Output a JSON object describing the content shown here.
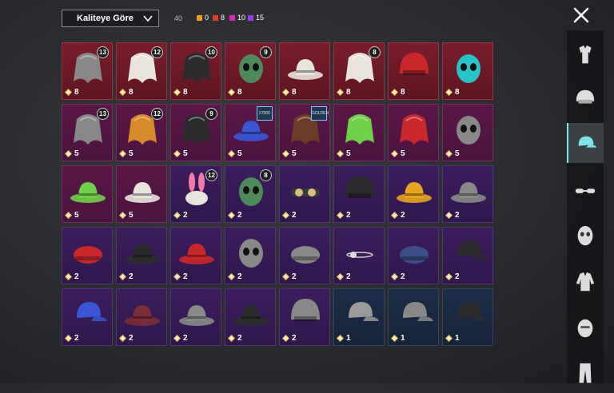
{
  "top": {
    "sort_label": "Kaliteye Göre",
    "total": "40",
    "quality_counts": [
      {
        "color": "#f0a020",
        "value": "0"
      },
      {
        "color": "#e23a2e",
        "value": "8"
      },
      {
        "color": "#d928b8",
        "value": "10"
      },
      {
        "color": "#9a3de6",
        "value": "15"
      }
    ]
  },
  "items": [
    {
      "quality": "red",
      "icon": "witch-hat-hair-icon",
      "level": "13",
      "count": "8"
    },
    {
      "quality": "red",
      "icon": "white-hair-bunny-icon",
      "level": "12",
      "count": "8"
    },
    {
      "quality": "red",
      "icon": "dark-curly-hair-icon",
      "level": "10",
      "count": "8"
    },
    {
      "quality": "red",
      "icon": "zombie-mask-icon",
      "level": "9",
      "count": "8"
    },
    {
      "quality": "red",
      "icon": "white-cowboy-hat-icon",
      "level": "",
      "count": "8"
    },
    {
      "quality": "red",
      "icon": "white-hair-bow-icon",
      "level": "8",
      "count": "8"
    },
    {
      "quality": "red",
      "icon": "red-helmet-icon",
      "level": "",
      "count": "8"
    },
    {
      "quality": "red",
      "icon": "cyan-horned-mask-icon",
      "level": "",
      "count": "8"
    },
    {
      "quality": "magenta",
      "icon": "hat-hair-duo-icon",
      "level": "13",
      "count": "5"
    },
    {
      "quality": "magenta",
      "icon": "orange-hair-icon",
      "level": "12",
      "count": "5"
    },
    {
      "quality": "magenta",
      "icon": "dark-long-hair-icon",
      "level": "9",
      "count": "5"
    },
    {
      "quality": "magenta",
      "icon": "blue-feather-headdress-icon",
      "level": "",
      "count": "5",
      "tag": "27000"
    },
    {
      "quality": "magenta",
      "icon": "brown-hair-icon",
      "level": "",
      "count": "5",
      "tag": "GOLDEN"
    },
    {
      "quality": "magenta",
      "icon": "green-cap-hair-icon",
      "level": "",
      "count": "5"
    },
    {
      "quality": "magenta",
      "icon": "red-beanie-hair-icon",
      "level": "",
      "count": "5"
    },
    {
      "quality": "magenta",
      "icon": "bunny-skull-mask-icon",
      "level": "",
      "count": "5"
    },
    {
      "quality": "magenta",
      "icon": "green-frog-hat-icon",
      "level": "",
      "count": "5"
    },
    {
      "quality": "magenta",
      "icon": "white-bucket-hat-icon",
      "level": "",
      "count": "5"
    },
    {
      "quality": "purple",
      "icon": "bunny-ears-icon",
      "level": "12",
      "count": "2"
    },
    {
      "quality": "purple",
      "icon": "alien-mask-icon",
      "level": "8",
      "count": "2"
    },
    {
      "quality": "purple",
      "icon": "goggles-hat-icon",
      "level": "",
      "count": "2"
    },
    {
      "quality": "purple",
      "icon": "dark-helmet-s12-icon",
      "level": "",
      "count": "2"
    },
    {
      "quality": "purple",
      "icon": "yellow-bucket-hat-icon",
      "level": "",
      "count": "2"
    },
    {
      "quality": "purple",
      "icon": "shark-hat-icon",
      "level": "",
      "count": "2"
    },
    {
      "quality": "purple",
      "icon": "red-beret-icon",
      "level": "",
      "count": "2"
    },
    {
      "quality": "purple",
      "icon": "black-fedora-icon",
      "level": "",
      "count": "2"
    },
    {
      "quality": "purple",
      "icon": "red-fedora-icon",
      "level": "",
      "count": "2"
    },
    {
      "quality": "purple",
      "icon": "shark-mask-icon",
      "level": "",
      "count": "2"
    },
    {
      "quality": "purple",
      "icon": "knit-beanie-icon",
      "level": "",
      "count": "2"
    },
    {
      "quality": "purple",
      "icon": "headlamp-icon",
      "level": "",
      "count": "2"
    },
    {
      "quality": "purple",
      "icon": "navy-beanie-icon",
      "level": "",
      "count": "2"
    },
    {
      "quality": "purple",
      "icon": "black-cap-icon",
      "level": "",
      "count": "2"
    },
    {
      "quality": "purple",
      "icon": "blue-cap-icon",
      "level": "",
      "count": "2"
    },
    {
      "quality": "purple",
      "icon": "maroon-hat-icon",
      "level": "",
      "count": "2"
    },
    {
      "quality": "purple",
      "icon": "plaid-hat-icon",
      "level": "",
      "count": "2"
    },
    {
      "quality": "purple",
      "icon": "black-bucket-hat-icon",
      "level": "",
      "count": "2"
    },
    {
      "quality": "purple",
      "icon": "aviator-helmet-icon",
      "level": "",
      "count": "2"
    },
    {
      "quality": "blue",
      "icon": "gray-flat-cap-icon",
      "level": "",
      "count": "1"
    },
    {
      "quality": "blue",
      "icon": "trucker-cap-icon",
      "level": "",
      "count": "1"
    },
    {
      "quality": "blue",
      "icon": "dark-gray-cap-icon",
      "level": "",
      "count": "1"
    }
  ],
  "categories": [
    {
      "icon": "outfit-icon",
      "active": false
    },
    {
      "icon": "helmet-icon",
      "active": false
    },
    {
      "icon": "cap-icon",
      "active": true
    },
    {
      "icon": "glasses-icon",
      "active": false
    },
    {
      "icon": "face-mask-icon",
      "active": false
    },
    {
      "icon": "jacket-icon",
      "active": false
    },
    {
      "icon": "face-icon",
      "active": false
    },
    {
      "icon": "pants-icon",
      "active": false
    }
  ]
}
